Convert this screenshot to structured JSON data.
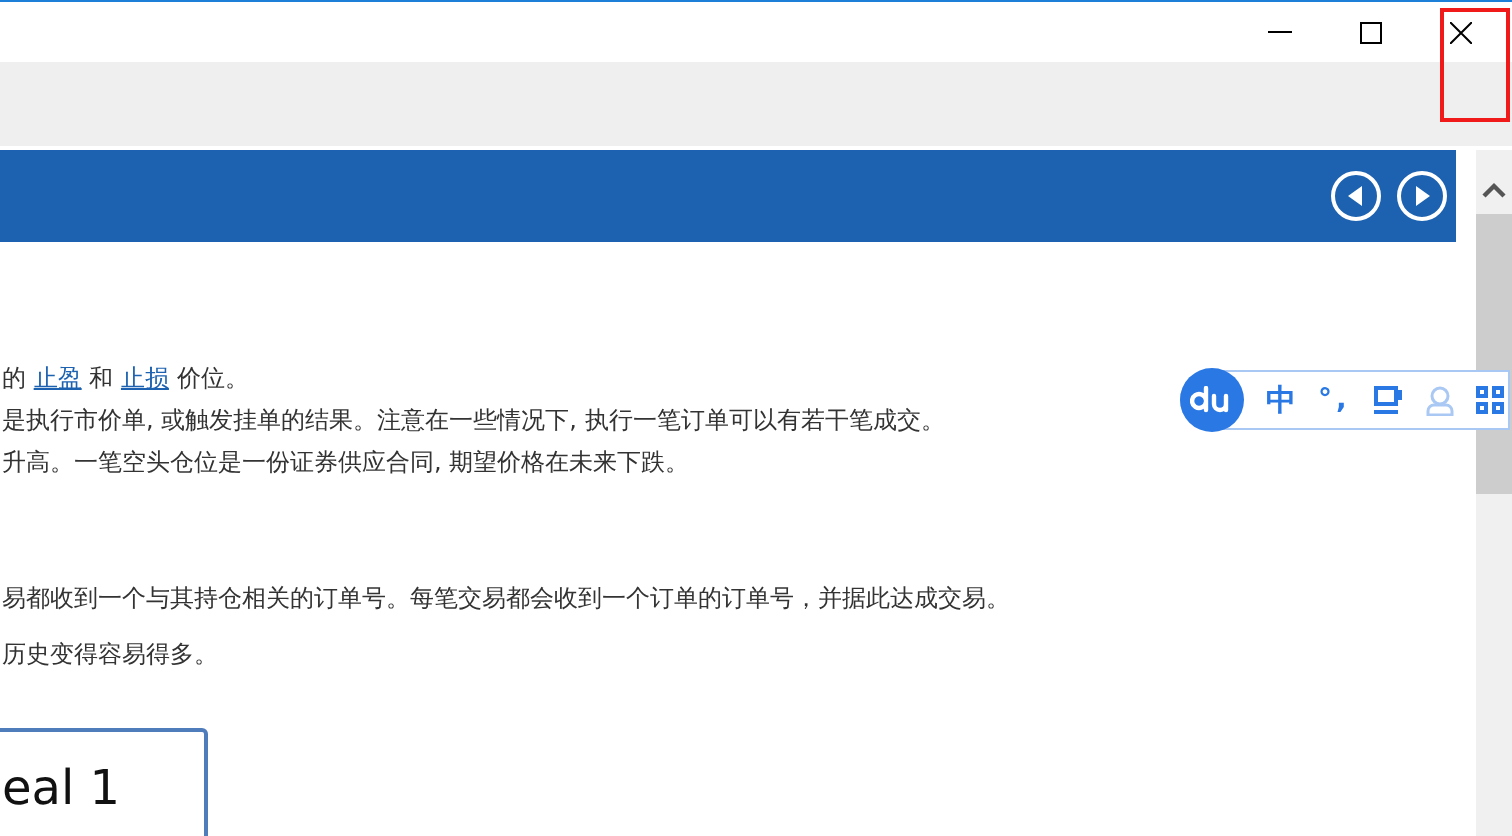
{
  "paragraphs": [
    {
      "segments": [
        {
          "text": "的 ",
          "link": false
        },
        {
          "text": "止盈",
          "link": true
        },
        {
          "text": " 和 ",
          "link": false
        },
        {
          "text": "止损",
          "link": true
        },
        {
          "text": " 价位。",
          "link": false
        }
      ],
      "gap": false
    },
    {
      "segments": [
        {
          "text": "是执行市价单, 或触发挂单的结果。注意在一些情况下, 执行一笔订单可以有若干笔成交。",
          "link": false
        }
      ],
      "gap": false
    },
    {
      "segments": [
        {
          "text": "升高。一笔空头仓位是一份证券供应合同, 期望价格在未来下跌。",
          "link": false
        }
      ],
      "gap": false
    },
    {
      "segments": [
        {
          "text": "易都收到一个与其持仓相关的订单号。每笔交易都会收到一个订单的订单号，并据此达成交易。",
          "link": false
        }
      ],
      "gap": true
    },
    {
      "segments": [
        {
          "text": "历史变得容易得多。",
          "link": false
        }
      ],
      "gap": false
    }
  ],
  "deal_box": {
    "label": "eal 1"
  },
  "ime_bar": {
    "mode": "中",
    "punctuation": "°,"
  }
}
